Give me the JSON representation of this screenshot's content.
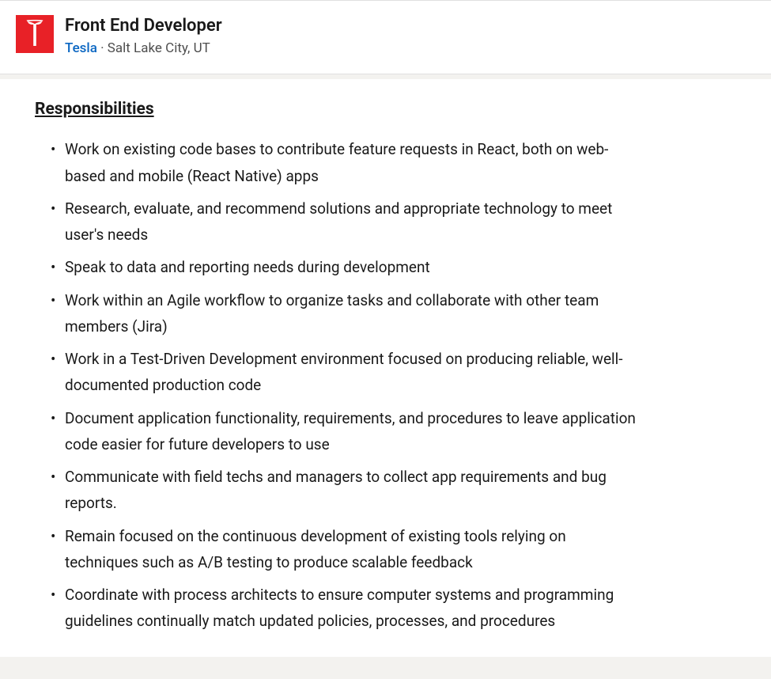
{
  "header": {
    "job_title": "Front End Developer",
    "company_name": "Tesla",
    "separator": " · ",
    "location": "Salt Lake City, UT"
  },
  "section": {
    "heading": "Responsibilities",
    "items": [
      "Work on existing code bases to contribute feature requests in React, both on web-based and mobile (React Native) apps",
      "Research, evaluate, and recommend solutions and appropriate technology to meet user's needs",
      "Speak to data and reporting needs during development",
      "Work within an Agile workflow to organize tasks and collaborate with other team members (Jira)",
      "Work in a Test-Driven Development environment focused on producing reliable, well-documented production code",
      "Document application functionality, requirements, and procedures to leave application code easier for future developers to use",
      "Communicate with field techs and managers to collect app requirements and bug reports.",
      "Remain focused on the continuous development of existing tools relying on techniques such as A/B testing to produce scalable feedback",
      "Coordinate with process architects to ensure computer systems and programming guidelines continually match updated policies, processes, and procedures"
    ]
  }
}
